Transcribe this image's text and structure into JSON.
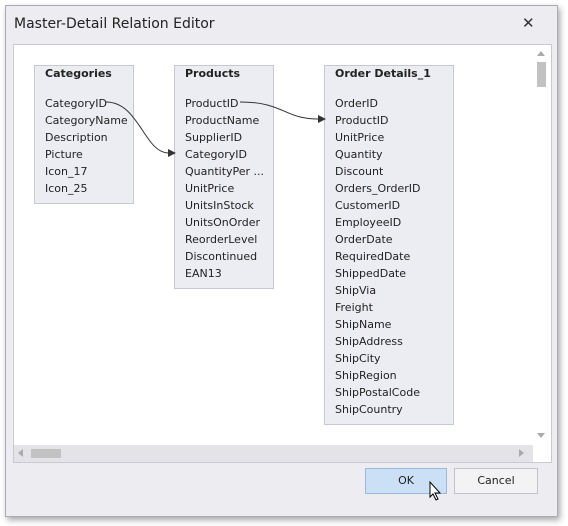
{
  "dialog": {
    "title": "Master-Detail Relation Editor",
    "close_icon": "close-icon"
  },
  "tables": [
    {
      "name": "Categories",
      "fields": [
        "CategoryID",
        "CategoryName",
        "Description",
        "Picture",
        "Icon_17",
        "Icon_25"
      ]
    },
    {
      "name": "Products",
      "fields": [
        "ProductID",
        "ProductName",
        "SupplierID",
        "CategoryID",
        "QuantityPer   ...",
        "UnitPrice",
        "UnitsInStock",
        "UnitsOnOrder",
        "ReorderLevel",
        "Discontinued",
        "EAN13"
      ]
    },
    {
      "name": "Order Details_1",
      "fields": [
        "OrderID",
        "ProductID",
        "UnitPrice",
        "Quantity",
        "Discount",
        "Orders_OrderID",
        "CustomerID",
        "EmployeeID",
        "OrderDate",
        "RequiredDate",
        "ShippedDate",
        "ShipVia",
        "Freight",
        "ShipName",
        "ShipAddress",
        "ShipCity",
        "ShipRegion",
        "ShipPostalCode",
        "ShipCountry"
      ]
    }
  ],
  "relations": [
    {
      "from": "Categories.CategoryID",
      "to": "Products.CategoryID"
    },
    {
      "from": "Products.ProductID",
      "to": "Order Details_1.ProductID"
    }
  ],
  "buttons": {
    "ok": "OK",
    "cancel": "Cancel"
  },
  "colors": {
    "ok_bg": "#cce0f5",
    "ok_border": "#99b9e0"
  }
}
